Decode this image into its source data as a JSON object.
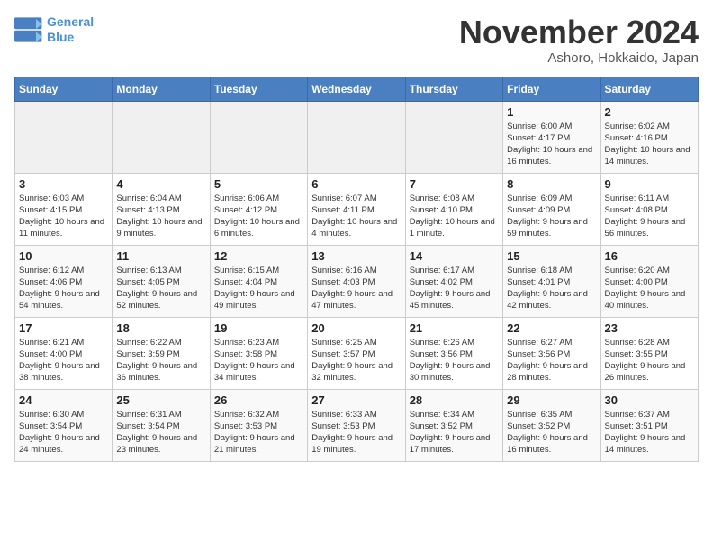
{
  "header": {
    "logo_line1": "General",
    "logo_line2": "Blue",
    "month": "November 2024",
    "location": "Ashoro, Hokkaido, Japan"
  },
  "days_of_week": [
    "Sunday",
    "Monday",
    "Tuesday",
    "Wednesday",
    "Thursday",
    "Friday",
    "Saturday"
  ],
  "weeks": [
    [
      {
        "day": "",
        "info": ""
      },
      {
        "day": "",
        "info": ""
      },
      {
        "day": "",
        "info": ""
      },
      {
        "day": "",
        "info": ""
      },
      {
        "day": "",
        "info": ""
      },
      {
        "day": "1",
        "info": "Sunrise: 6:00 AM\nSunset: 4:17 PM\nDaylight: 10 hours and 16 minutes."
      },
      {
        "day": "2",
        "info": "Sunrise: 6:02 AM\nSunset: 4:16 PM\nDaylight: 10 hours and 14 minutes."
      }
    ],
    [
      {
        "day": "3",
        "info": "Sunrise: 6:03 AM\nSunset: 4:15 PM\nDaylight: 10 hours and 11 minutes."
      },
      {
        "day": "4",
        "info": "Sunrise: 6:04 AM\nSunset: 4:13 PM\nDaylight: 10 hours and 9 minutes."
      },
      {
        "day": "5",
        "info": "Sunrise: 6:06 AM\nSunset: 4:12 PM\nDaylight: 10 hours and 6 minutes."
      },
      {
        "day": "6",
        "info": "Sunrise: 6:07 AM\nSunset: 4:11 PM\nDaylight: 10 hours and 4 minutes."
      },
      {
        "day": "7",
        "info": "Sunrise: 6:08 AM\nSunset: 4:10 PM\nDaylight: 10 hours and 1 minute."
      },
      {
        "day": "8",
        "info": "Sunrise: 6:09 AM\nSunset: 4:09 PM\nDaylight: 9 hours and 59 minutes."
      },
      {
        "day": "9",
        "info": "Sunrise: 6:11 AM\nSunset: 4:08 PM\nDaylight: 9 hours and 56 minutes."
      }
    ],
    [
      {
        "day": "10",
        "info": "Sunrise: 6:12 AM\nSunset: 4:06 PM\nDaylight: 9 hours and 54 minutes."
      },
      {
        "day": "11",
        "info": "Sunrise: 6:13 AM\nSunset: 4:05 PM\nDaylight: 9 hours and 52 minutes."
      },
      {
        "day": "12",
        "info": "Sunrise: 6:15 AM\nSunset: 4:04 PM\nDaylight: 9 hours and 49 minutes."
      },
      {
        "day": "13",
        "info": "Sunrise: 6:16 AM\nSunset: 4:03 PM\nDaylight: 9 hours and 47 minutes."
      },
      {
        "day": "14",
        "info": "Sunrise: 6:17 AM\nSunset: 4:02 PM\nDaylight: 9 hours and 45 minutes."
      },
      {
        "day": "15",
        "info": "Sunrise: 6:18 AM\nSunset: 4:01 PM\nDaylight: 9 hours and 42 minutes."
      },
      {
        "day": "16",
        "info": "Sunrise: 6:20 AM\nSunset: 4:00 PM\nDaylight: 9 hours and 40 minutes."
      }
    ],
    [
      {
        "day": "17",
        "info": "Sunrise: 6:21 AM\nSunset: 4:00 PM\nDaylight: 9 hours and 38 minutes."
      },
      {
        "day": "18",
        "info": "Sunrise: 6:22 AM\nSunset: 3:59 PM\nDaylight: 9 hours and 36 minutes."
      },
      {
        "day": "19",
        "info": "Sunrise: 6:23 AM\nSunset: 3:58 PM\nDaylight: 9 hours and 34 minutes."
      },
      {
        "day": "20",
        "info": "Sunrise: 6:25 AM\nSunset: 3:57 PM\nDaylight: 9 hours and 32 minutes."
      },
      {
        "day": "21",
        "info": "Sunrise: 6:26 AM\nSunset: 3:56 PM\nDaylight: 9 hours and 30 minutes."
      },
      {
        "day": "22",
        "info": "Sunrise: 6:27 AM\nSunset: 3:56 PM\nDaylight: 9 hours and 28 minutes."
      },
      {
        "day": "23",
        "info": "Sunrise: 6:28 AM\nSunset: 3:55 PM\nDaylight: 9 hours and 26 minutes."
      }
    ],
    [
      {
        "day": "24",
        "info": "Sunrise: 6:30 AM\nSunset: 3:54 PM\nDaylight: 9 hours and 24 minutes."
      },
      {
        "day": "25",
        "info": "Sunrise: 6:31 AM\nSunset: 3:54 PM\nDaylight: 9 hours and 23 minutes."
      },
      {
        "day": "26",
        "info": "Sunrise: 6:32 AM\nSunset: 3:53 PM\nDaylight: 9 hours and 21 minutes."
      },
      {
        "day": "27",
        "info": "Sunrise: 6:33 AM\nSunset: 3:53 PM\nDaylight: 9 hours and 19 minutes."
      },
      {
        "day": "28",
        "info": "Sunrise: 6:34 AM\nSunset: 3:52 PM\nDaylight: 9 hours and 17 minutes."
      },
      {
        "day": "29",
        "info": "Sunrise: 6:35 AM\nSunset: 3:52 PM\nDaylight: 9 hours and 16 minutes."
      },
      {
        "day": "30",
        "info": "Sunrise: 6:37 AM\nSunset: 3:51 PM\nDaylight: 9 hours and 14 minutes."
      }
    ]
  ]
}
